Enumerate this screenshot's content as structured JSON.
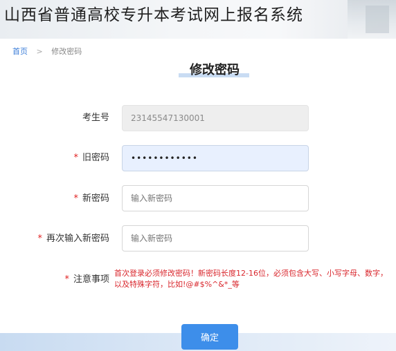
{
  "header": {
    "title": "山西省普通高校专升本考试网上报名系统"
  },
  "breadcrumb": {
    "home": "首页",
    "separator": ">",
    "current": "修改密码"
  },
  "page": {
    "title": "修改密码"
  },
  "form": {
    "exam_id": {
      "label": "考生号",
      "value": "23145547130001"
    },
    "old_password": {
      "required_mark": "*",
      "label": "旧密码",
      "value": "••••••••••••"
    },
    "new_password": {
      "required_mark": "*",
      "label": "新密码",
      "placeholder": "输入新密码"
    },
    "confirm_password": {
      "required_mark": "*",
      "label": "再次输入新密码",
      "placeholder": "输入新密码"
    },
    "notice": {
      "required_mark": "*",
      "label": "注意事项",
      "text": "首次登录必须修改密码！新密码长度12-16位，必须包含大写、小写字母、数字，以及特殊字符，比如!@#$%^&*_等"
    },
    "submit_label": "确定"
  },
  "colors": {
    "accent": "#3d8eea",
    "link": "#3b7dd8",
    "warning_text": "#d9262c"
  }
}
